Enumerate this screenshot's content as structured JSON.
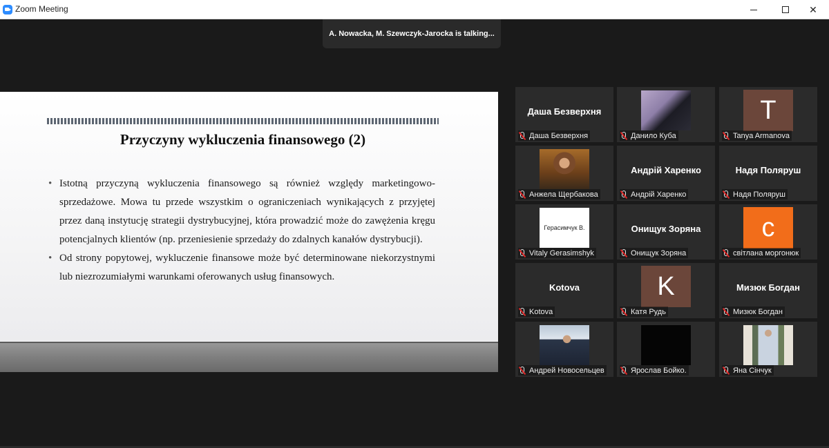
{
  "window": {
    "title": "Zoom Meeting"
  },
  "talking": {
    "text": "A. Nowacka, M. Szewczyk-Jarocka is talking..."
  },
  "slide": {
    "title": "Przyczyny wykluczenia finansowego (2)",
    "bullets": [
      "Istotną przyczyną wykluczenia finansowego są również względy marketingowo-sprzedażowe. Mowa tu przede wszystkim o ograniczeniach wynikających z przyjętej przez daną instytucję strategii dystrybucyjnej, która prowadzić może do zawężenia kręgu potencjalnych klientów (np. przeniesienie sprzedaży do zdalnych kanałów dystrybucji).",
      "Od strony popytowej, wykluczenie finansowe może być determinowane niekorzystnymi lub niezrozumiałymi warunkami oferowanych usług finansowych."
    ]
  },
  "participants": [
    {
      "label": "Даша Безверхня",
      "display": "Даша Безверхня",
      "type": "name"
    },
    {
      "label": "Данило Куба",
      "type": "photo",
      "icon": "person-photo-icon"
    },
    {
      "label": "Tanya Armanova",
      "type": "letter",
      "letter": "T",
      "color": "#6b463a"
    },
    {
      "label": "Анжела Щербакова",
      "type": "photo",
      "icon": "person-photo-icon"
    },
    {
      "label": "Андрій Харенко",
      "display": "Андрій Харенко",
      "type": "name"
    },
    {
      "label": "Надя Поляруш",
      "display": "Надя Поляруш",
      "type": "name"
    },
    {
      "label": "Vitaly Gerasimshyk",
      "card_text": "Герасимчук В.",
      "type": "card"
    },
    {
      "label": "Онищук Зоряна",
      "display": "Онищук Зоряна",
      "type": "name"
    },
    {
      "label": "світлана моргонюк",
      "type": "letter",
      "letter": "с",
      "color": "#f26d1a"
    },
    {
      "label": "Kotova",
      "display": "Kotova",
      "type": "name"
    },
    {
      "label": "Катя Рудь",
      "type": "letter",
      "letter": "K",
      "color": "#6b463a"
    },
    {
      "label": "Мизюк Богдан",
      "display": "Мизюк Богдан",
      "type": "name"
    },
    {
      "label": "Андрей Новосельцев",
      "type": "photo",
      "icon": "person-photo-icon"
    },
    {
      "label": "Ярослав Бойко.",
      "type": "black"
    },
    {
      "label": "Яна Сінчук",
      "type": "photo",
      "icon": "person-photo-icon"
    }
  ]
}
